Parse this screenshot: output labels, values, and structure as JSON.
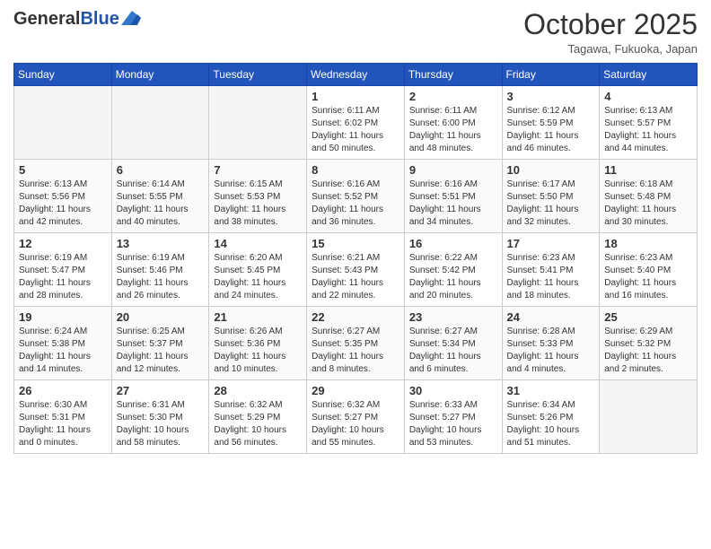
{
  "header": {
    "logo_general": "General",
    "logo_blue": "Blue",
    "month": "October 2025",
    "location": "Tagawa, Fukuoka, Japan"
  },
  "days_of_week": [
    "Sunday",
    "Monday",
    "Tuesday",
    "Wednesday",
    "Thursday",
    "Friday",
    "Saturday"
  ],
  "weeks": [
    [
      {
        "day": "",
        "info": ""
      },
      {
        "day": "",
        "info": ""
      },
      {
        "day": "",
        "info": ""
      },
      {
        "day": "1",
        "info": "Sunrise: 6:11 AM\nSunset: 6:02 PM\nDaylight: 11 hours\nand 50 minutes."
      },
      {
        "day": "2",
        "info": "Sunrise: 6:11 AM\nSunset: 6:00 PM\nDaylight: 11 hours\nand 48 minutes."
      },
      {
        "day": "3",
        "info": "Sunrise: 6:12 AM\nSunset: 5:59 PM\nDaylight: 11 hours\nand 46 minutes."
      },
      {
        "day": "4",
        "info": "Sunrise: 6:13 AM\nSunset: 5:57 PM\nDaylight: 11 hours\nand 44 minutes."
      }
    ],
    [
      {
        "day": "5",
        "info": "Sunrise: 6:13 AM\nSunset: 5:56 PM\nDaylight: 11 hours\nand 42 minutes."
      },
      {
        "day": "6",
        "info": "Sunrise: 6:14 AM\nSunset: 5:55 PM\nDaylight: 11 hours\nand 40 minutes."
      },
      {
        "day": "7",
        "info": "Sunrise: 6:15 AM\nSunset: 5:53 PM\nDaylight: 11 hours\nand 38 minutes."
      },
      {
        "day": "8",
        "info": "Sunrise: 6:16 AM\nSunset: 5:52 PM\nDaylight: 11 hours\nand 36 minutes."
      },
      {
        "day": "9",
        "info": "Sunrise: 6:16 AM\nSunset: 5:51 PM\nDaylight: 11 hours\nand 34 minutes."
      },
      {
        "day": "10",
        "info": "Sunrise: 6:17 AM\nSunset: 5:50 PM\nDaylight: 11 hours\nand 32 minutes."
      },
      {
        "day": "11",
        "info": "Sunrise: 6:18 AM\nSunset: 5:48 PM\nDaylight: 11 hours\nand 30 minutes."
      }
    ],
    [
      {
        "day": "12",
        "info": "Sunrise: 6:19 AM\nSunset: 5:47 PM\nDaylight: 11 hours\nand 28 minutes."
      },
      {
        "day": "13",
        "info": "Sunrise: 6:19 AM\nSunset: 5:46 PM\nDaylight: 11 hours\nand 26 minutes."
      },
      {
        "day": "14",
        "info": "Sunrise: 6:20 AM\nSunset: 5:45 PM\nDaylight: 11 hours\nand 24 minutes."
      },
      {
        "day": "15",
        "info": "Sunrise: 6:21 AM\nSunset: 5:43 PM\nDaylight: 11 hours\nand 22 minutes."
      },
      {
        "day": "16",
        "info": "Sunrise: 6:22 AM\nSunset: 5:42 PM\nDaylight: 11 hours\nand 20 minutes."
      },
      {
        "day": "17",
        "info": "Sunrise: 6:23 AM\nSunset: 5:41 PM\nDaylight: 11 hours\nand 18 minutes."
      },
      {
        "day": "18",
        "info": "Sunrise: 6:23 AM\nSunset: 5:40 PM\nDaylight: 11 hours\nand 16 minutes."
      }
    ],
    [
      {
        "day": "19",
        "info": "Sunrise: 6:24 AM\nSunset: 5:38 PM\nDaylight: 11 hours\nand 14 minutes."
      },
      {
        "day": "20",
        "info": "Sunrise: 6:25 AM\nSunset: 5:37 PM\nDaylight: 11 hours\nand 12 minutes."
      },
      {
        "day": "21",
        "info": "Sunrise: 6:26 AM\nSunset: 5:36 PM\nDaylight: 11 hours\nand 10 minutes."
      },
      {
        "day": "22",
        "info": "Sunrise: 6:27 AM\nSunset: 5:35 PM\nDaylight: 11 hours\nand 8 minutes."
      },
      {
        "day": "23",
        "info": "Sunrise: 6:27 AM\nSunset: 5:34 PM\nDaylight: 11 hours\nand 6 minutes."
      },
      {
        "day": "24",
        "info": "Sunrise: 6:28 AM\nSunset: 5:33 PM\nDaylight: 11 hours\nand 4 minutes."
      },
      {
        "day": "25",
        "info": "Sunrise: 6:29 AM\nSunset: 5:32 PM\nDaylight: 11 hours\nand 2 minutes."
      }
    ],
    [
      {
        "day": "26",
        "info": "Sunrise: 6:30 AM\nSunset: 5:31 PM\nDaylight: 11 hours\nand 0 minutes."
      },
      {
        "day": "27",
        "info": "Sunrise: 6:31 AM\nSunset: 5:30 PM\nDaylight: 10 hours\nand 58 minutes."
      },
      {
        "day": "28",
        "info": "Sunrise: 6:32 AM\nSunset: 5:29 PM\nDaylight: 10 hours\nand 56 minutes."
      },
      {
        "day": "29",
        "info": "Sunrise: 6:32 AM\nSunset: 5:27 PM\nDaylight: 10 hours\nand 55 minutes."
      },
      {
        "day": "30",
        "info": "Sunrise: 6:33 AM\nSunset: 5:27 PM\nDaylight: 10 hours\nand 53 minutes."
      },
      {
        "day": "31",
        "info": "Sunrise: 6:34 AM\nSunset: 5:26 PM\nDaylight: 10 hours\nand 51 minutes."
      },
      {
        "day": "",
        "info": ""
      }
    ]
  ]
}
